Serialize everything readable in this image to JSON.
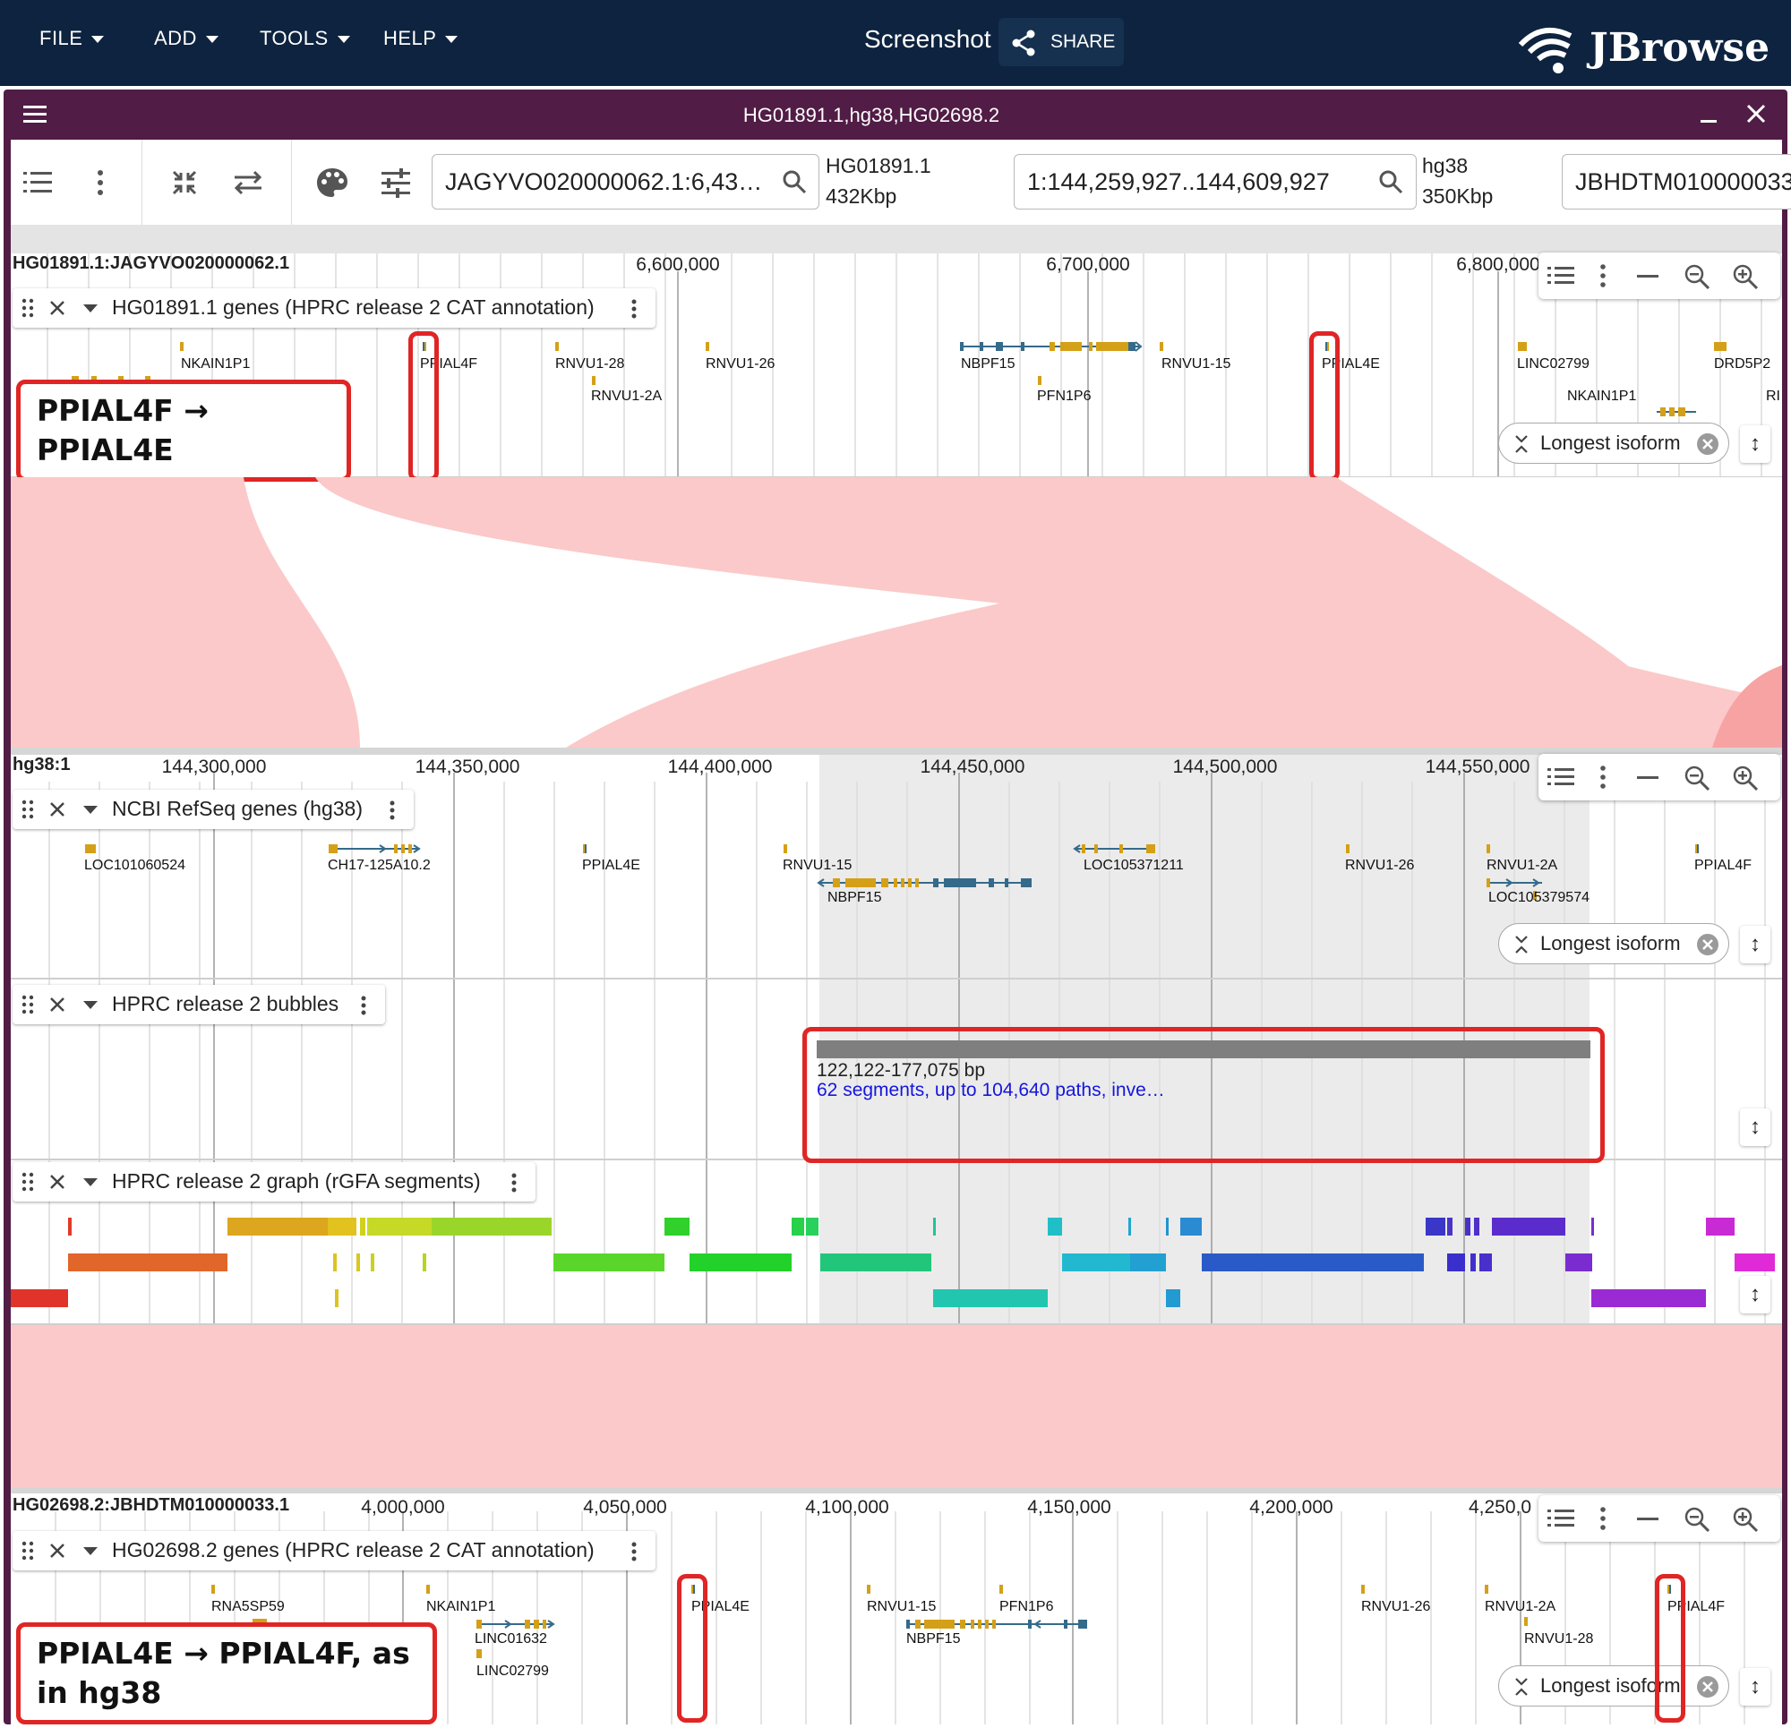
{
  "app": {
    "menus": [
      {
        "label": "FILE"
      },
      {
        "label": "ADD"
      },
      {
        "label": "TOOLS"
      },
      {
        "label": "HELP"
      }
    ],
    "screenshot_label": "Screenshot",
    "share_label": "SHARE",
    "logo": "JBrowse"
  },
  "view": {
    "title": "HG01891.1,hg38,HG02698.2",
    "minimize_icon": "minimize-icon",
    "close_icon": "close-icon",
    "search_inputs": [
      {
        "value": "JAGYVO020000062.1:6,43…",
        "assembly": "HG01891.1",
        "size": "432Kbp"
      },
      {
        "value": "1:144,259,927..144,609,927",
        "assembly": "hg38",
        "size": "350Kbp"
      },
      {
        "value": "JBHDTM010000033"
      }
    ]
  },
  "panels": {
    "top": {
      "ruler_label": "HG01891.1:JAGYVO020000062.1",
      "ticks": [
        {
          "label": "6,600,000",
          "pos": 6600000
        },
        {
          "label": "6,700,000",
          "pos": 6700000
        },
        {
          "label": "6,800,000",
          "pos": 6800000
        }
      ],
      "track_name": "HG01891.1 genes (HPRC release 2 CAT annotation)",
      "genes": [
        {
          "label": "NKAIN1P1"
        },
        {
          "label": "PPIAL4F"
        },
        {
          "label": "RNVU1-28"
        },
        {
          "label": "RNVU1-2A"
        },
        {
          "label": "RNVU1-26"
        },
        {
          "label": "NBPF15"
        },
        {
          "label": "PFN1P6"
        },
        {
          "label": "RNVU1-15"
        },
        {
          "label": "PPIAL4E"
        },
        {
          "label": "LINC02799"
        },
        {
          "label": "NKAIN1P1"
        },
        {
          "label": "DRD5P2"
        },
        {
          "label": "RI"
        }
      ],
      "isoform_label": "Longest isoform",
      "callout": "PPIAL4F → PPIAL4E"
    },
    "middle": {
      "ruler_label": "hg38:1",
      "ticks": [
        {
          "label": "144,300,000",
          "pos": 144300000
        },
        {
          "label": "144,350,000",
          "pos": 144350000
        },
        {
          "label": "144,400,000",
          "pos": 144400000
        },
        {
          "label": "144,450,000",
          "pos": 144450000
        },
        {
          "label": "144,500,000",
          "pos": 144500000
        },
        {
          "label": "144,550,000",
          "pos": 144550000
        }
      ],
      "tracks": {
        "refseq": {
          "name": "NCBI RefSeq genes (hg38)",
          "genes": [
            {
              "label": "LOC101060524"
            },
            {
              "label": "CH17-125A10.2"
            },
            {
              "label": "PPIAL4E"
            },
            {
              "label": "RNVU1-15"
            },
            {
              "label": "NBPF15"
            },
            {
              "label": "LOC105371211"
            },
            {
              "label": "RNVU1-26"
            },
            {
              "label": "RNVU1-2A"
            },
            {
              "label": "LOC105379574"
            },
            {
              "label": "PPIAL4F"
            }
          ],
          "isoform_label": "Longest isoform"
        },
        "bubbles": {
          "name": "HPRC release 2 bubbles",
          "feature_range": "122,122-177,075 bp",
          "feature_desc": "62 segments, up to 104,640 paths, inve…"
        },
        "graph": {
          "name": "HPRC release 2 graph (rGFA segments)"
        }
      }
    },
    "bottom": {
      "ruler_label": "HG02698.2:JBHDTM010000033.1",
      "ticks": [
        {
          "label": "4,000,000",
          "pos": 4000000
        },
        {
          "label": "4,050,000",
          "pos": 4050000
        },
        {
          "label": "4,100,000",
          "pos": 4100000
        },
        {
          "label": "4,150,000",
          "pos": 4150000
        },
        {
          "label": "4,200,000",
          "pos": 4200000
        },
        {
          "label": "4,250,0",
          "pos": 4250000
        }
      ],
      "track_name": "HG02698.2 genes (HPRC release 2 CAT annotation)",
      "genes": [
        {
          "label": "RNA5SP59"
        },
        {
          "label": "NKAIN1P1"
        },
        {
          "label": "LINC01632"
        },
        {
          "label": "LINC02799"
        },
        {
          "label": "PPIAL4E"
        },
        {
          "label": "RNVU1-15"
        },
        {
          "label": "NBPF15"
        },
        {
          "label": "PFN1P6"
        },
        {
          "label": "RNVU1-26"
        },
        {
          "label": "RNVU1-2A"
        },
        {
          "label": "RNVU1-28"
        },
        {
          "label": "PPIAL4F"
        }
      ],
      "isoform_label": "Longest isoform",
      "callout": "PPIAL4E → PPIAL4F, as in hg38"
    }
  },
  "colors": {
    "appbar": "#0d233f",
    "frame": "#511c45",
    "synteny": "#fbc9c9",
    "highlight": "#e02525",
    "gene_gold": "#d4a017",
    "gene_blue": "#356a8a"
  }
}
